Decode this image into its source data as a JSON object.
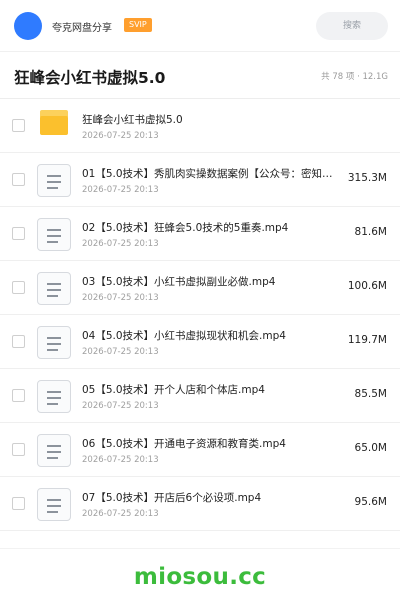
{
  "header": {
    "app_name": "夸克网盘分享",
    "badge": "SVIP",
    "search_label": "搜索"
  },
  "folder": {
    "title": "狂峰会小红书虚拟5.0",
    "meta": "共 78 项 · 12.1G"
  },
  "items": [
    {
      "type": "folder",
      "name": "狂峰会小红书虚拟5.0",
      "date": "2026-07-25 20:13",
      "size": ""
    },
    {
      "type": "file",
      "name": "01【5.0技术】秀肌肉实操数据案例【公众号：密知…",
      "date": "2026-07-25 20:13",
      "size": "315.3M"
    },
    {
      "type": "file",
      "name": "02【5.0技术】狂蜂会5.0技术的5重奏.mp4",
      "date": "2026-07-25 20:13",
      "size": "81.6M"
    },
    {
      "type": "file",
      "name": "03【5.0技术】小红书虚拟副业必做.mp4",
      "date": "2026-07-25 20:13",
      "size": "100.6M"
    },
    {
      "type": "file",
      "name": "04【5.0技术】小红书虚拟现状和机会.mp4",
      "date": "2026-07-25 20:13",
      "size": "119.7M"
    },
    {
      "type": "file",
      "name": "05【5.0技术】开个人店和个体店.mp4",
      "date": "2026-07-25 20:13",
      "size": "85.5M"
    },
    {
      "type": "file",
      "name": "06【5.0技术】开通电子资源和教育类.mp4",
      "date": "2026-07-25 20:13",
      "size": "65.0M"
    },
    {
      "type": "file",
      "name": "07【5.0技术】开店后6个必设项.mp4",
      "date": "2026-07-25 20:13",
      "size": "95.6M"
    }
  ],
  "watermark": "miosou.cc",
  "colors": {
    "accent": "#2f7bff",
    "svip": "#ff9f2e",
    "folder": "#fbc02d",
    "watermark": "#3cbc3c"
  }
}
